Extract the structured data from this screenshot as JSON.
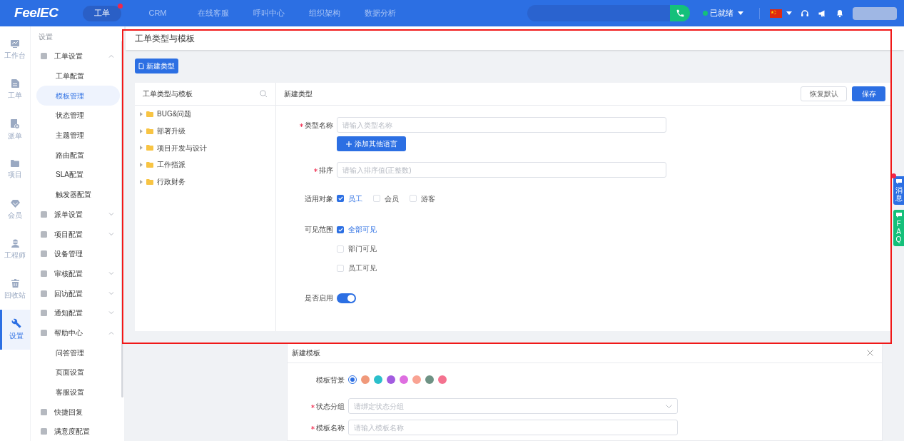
{
  "topbar": {
    "logo": "FeelEC",
    "nav": [
      {
        "label": "工单",
        "selected": true,
        "dot": true
      },
      {
        "label": "CRM",
        "selected": false,
        "dot": false
      },
      {
        "label": "在线客服",
        "selected": false,
        "dot": false
      },
      {
        "label": "呼叫中心",
        "selected": false,
        "dot": false
      },
      {
        "label": "组织架构",
        "selected": false,
        "dot": false
      },
      {
        "label": "数据分析",
        "selected": false,
        "dot": false
      }
    ],
    "status": "已就绪"
  },
  "rail": [
    {
      "label": "工作台",
      "selected": false
    },
    {
      "label": "工单",
      "selected": false
    },
    {
      "label": "派单",
      "selected": false
    },
    {
      "label": "项目",
      "selected": false
    },
    {
      "label": "会员",
      "selected": false
    },
    {
      "label": "工程师",
      "selected": false
    },
    {
      "label": "回收站",
      "selected": false
    },
    {
      "label": "设置",
      "selected": true
    }
  ],
  "sidebar": {
    "title": "设置",
    "items": [
      {
        "label": "工单设置",
        "kind": "group",
        "expanded": true,
        "children": [
          {
            "label": "工单配置",
            "selected": false
          },
          {
            "label": "模板管理",
            "selected": true
          },
          {
            "label": "状态管理",
            "selected": false
          },
          {
            "label": "主题管理",
            "selected": false
          },
          {
            "label": "路由配置",
            "selected": false
          },
          {
            "label": "SLA配置",
            "selected": false
          },
          {
            "label": "触发器配置",
            "selected": false
          }
        ]
      },
      {
        "label": "派单设置",
        "kind": "group",
        "expanded": false
      },
      {
        "label": "项目配置",
        "kind": "group",
        "expanded": false
      },
      {
        "label": "设备管理",
        "kind": "link"
      },
      {
        "label": "审核配置",
        "kind": "group",
        "expanded": false
      },
      {
        "label": "回访配置",
        "kind": "group",
        "expanded": false
      },
      {
        "label": "通知配置",
        "kind": "group",
        "expanded": false
      },
      {
        "label": "帮助中心",
        "kind": "group",
        "expanded": true,
        "children": [
          {
            "label": "问答管理",
            "selected": false
          },
          {
            "label": "页面设置",
            "selected": false
          },
          {
            "label": "客服设置",
            "selected": false
          }
        ]
      },
      {
        "label": "快捷回复",
        "kind": "link"
      },
      {
        "label": "满意度配置",
        "kind": "link"
      }
    ]
  },
  "page_title": "工单类型与模板",
  "new_type_button": "新建类型",
  "tree": {
    "title": "工单类型与模板",
    "items": [
      {
        "label": "BUG&问题",
        "expanded": false
      },
      {
        "label": "部署升级",
        "expanded": false
      },
      {
        "label": "项目开发与设计",
        "expanded": false
      },
      {
        "label": "工作指派",
        "expanded": false
      },
      {
        "label": "行政财务",
        "expanded": false
      }
    ]
  },
  "type_form": {
    "title": "新建类型",
    "reset_button": "恢复默认",
    "save_button": "保存",
    "type_name": {
      "label": "类型名称",
      "required": true,
      "placeholder": "请输入类型名称"
    },
    "add_language_button": "添加其他语言",
    "sort": {
      "label": "排序",
      "required": true,
      "placeholder": "请输入排序值(正整数)"
    },
    "applies_to": {
      "label": "适用对象",
      "options": [
        {
          "label": "员工",
          "checked": true
        },
        {
          "label": "会员",
          "checked": false
        },
        {
          "label": "游客",
          "checked": false
        }
      ]
    },
    "visibility": {
      "label": "可见范围",
      "options": [
        {
          "label": "全部可见",
          "checked": true
        },
        {
          "label": "部门可见",
          "checked": false
        },
        {
          "label": "员工可见",
          "checked": false
        }
      ]
    },
    "enabled": {
      "label": "是否启用",
      "on": true
    }
  },
  "template_card": {
    "title": "新建模板",
    "background": {
      "label": "模板背景",
      "swatches": [
        {
          "color": "#2c6fe3",
          "selected": true
        },
        {
          "color": "#f0997a",
          "selected": false
        },
        {
          "color": "#2bbfcb",
          "selected": false
        },
        {
          "color": "#a25ce0",
          "selected": false
        },
        {
          "color": "#de6ee0",
          "selected": false
        },
        {
          "color": "#f9a393",
          "selected": false
        },
        {
          "color": "#6e9284",
          "selected": false
        },
        {
          "color": "#f4728f",
          "selected": false
        }
      ]
    },
    "status_group": {
      "label": "状态分组",
      "required": true,
      "placeholder": "请绑定状态分组"
    },
    "template_name": {
      "label": "模板名称",
      "required": true,
      "placeholder": "请输入模板名称"
    }
  },
  "side_tabs": [
    {
      "label": "消息",
      "color": "#2c6fe3",
      "dot": true
    },
    {
      "label": "FAQ",
      "color": "#14c07a",
      "dot": false
    }
  ]
}
